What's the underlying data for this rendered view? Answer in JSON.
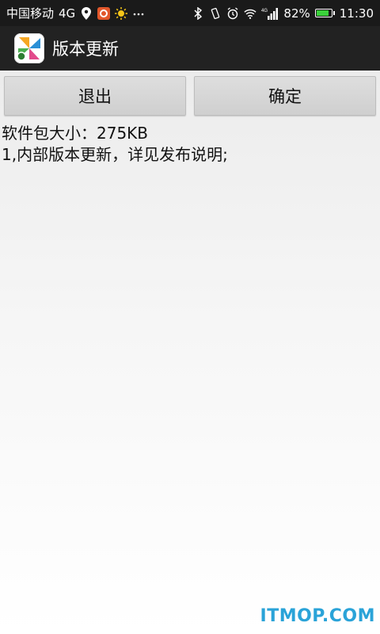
{
  "status_bar": {
    "carrier": "中国移动",
    "network": "4G",
    "signal_label": "4G",
    "battery_percent": "82%",
    "battery_level": 0.82,
    "time": "11:30"
  },
  "title_bar": {
    "title": "版本更新"
  },
  "buttons": {
    "exit_label": "退出",
    "confirm_label": "确定"
  },
  "info": {
    "size_line": "软件包大小：275KB",
    "notes_line": "1,内部版本更新，详见发布说明;"
  },
  "watermark": "ITMOP.COM",
  "colors": {
    "status_bg": "#1a1a1a",
    "title_bg": "#222222",
    "watermark": "#2aa3d8",
    "battery_fill": "#3ad13a"
  }
}
